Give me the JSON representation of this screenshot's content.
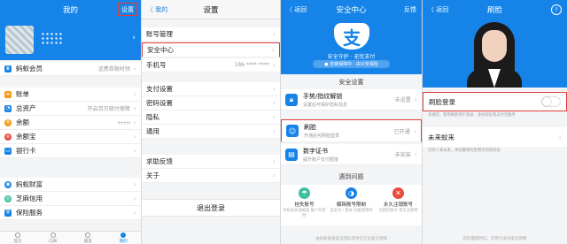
{
  "colors": {
    "brand_blue": "#1583e8",
    "highlight_red": "#e23b3b",
    "background": "#f3f4f6"
  },
  "panel1": {
    "title": "我的",
    "settings": "设置",
    "menu": [
      {
        "label": "蚂蚁会员",
        "value": "话费券限时领 ",
        "icon": "crown-icon",
        "color": "#1583e8"
      },
      {
        "label": "账单",
        "value": "",
        "icon": "bill-icon",
        "color": "#f39c12"
      },
      {
        "label": "总资产",
        "value": "开启百万级付保障",
        "icon": "pie-icon",
        "color": "#1583e8"
      },
      {
        "label": "余额",
        "value": "",
        "icon": "coin-icon",
        "color": "#f39c12"
      },
      {
        "label": "余额宝",
        "value": "",
        "icon": "yuebao-icon",
        "color": "#e84c3d"
      },
      {
        "label": "银行卡",
        "value": "",
        "icon": "card-icon",
        "color": "#1583e8"
      },
      {
        "label": "蚂蚁财富",
        "value": "",
        "icon": "wealth-icon",
        "color": "#1583e8"
      },
      {
        "label": "芝麻信用",
        "value": "",
        "icon": "sesame-icon",
        "color": "#3ebea1"
      },
      {
        "label": "保险服务",
        "value": "",
        "icon": "shield-icon",
        "color": "#1583e8"
      }
    ],
    "tabs": [
      "首页",
      "口碑",
      "朋友",
      "我的"
    ]
  },
  "panel2": {
    "back": "〈 我的",
    "title": "设置",
    "items": [
      {
        "label": "账号管理",
        "value": ""
      },
      {
        "label": "安全中心",
        "value": ""
      },
      {
        "label": "手机号",
        "value": "186 **** **** "
      },
      {
        "label": "支付设置",
        "value": ""
      },
      {
        "label": "密码设置",
        "value": ""
      },
      {
        "label": "隐私",
        "value": ""
      },
      {
        "label": "通用",
        "value": ""
      },
      {
        "label": "求助反馈",
        "value": ""
      },
      {
        "label": "关于",
        "value": ""
      }
    ],
    "logout": "退出登录"
  },
  "panel3": {
    "back": "〈 返回",
    "title": "安全中心",
    "feedback": "反馈",
    "shield_char": "支",
    "hero_line1": "安全守护 · 无忧支付",
    "hero_line2": "● 您被保障中 · 由众安保险",
    "section_settings": "安全设置",
    "settings": [
      {
        "title": "手势/指纹解锁",
        "subtitle": "设置后可保护隐私信息",
        "status": "未设置",
        "icon": "lock-icon"
      },
      {
        "title": "刷脸",
        "subtitle": "开通后可刷脸登录",
        "status": "已开通",
        "icon": "face-icon"
      },
      {
        "title": "数字证书",
        "subtitle": "提升账户支付额度",
        "status": "未安装",
        "icon": "cert-icon"
      }
    ],
    "section_problems": "遇到问题",
    "problems": [
      {
        "title": "挂失账号",
        "desc": "手机丢失或被盗 账户异常时",
        "color": "#3ebea1",
        "icon": "umbrella-icon"
      },
      {
        "title": "解除账号限制",
        "desc": "当支付 / 登录 功能受限时",
        "color": "#1583e8",
        "icon": "unlock-icon"
      },
      {
        "title": "永久注销账号",
        "desc": "注销后账号 将无法使用",
        "color": "#e84c3d",
        "icon": "delete-icon"
      }
    ],
    "footer": "由蚂蚁金服安全团队提供全方位安全保障"
  },
  "panel4": {
    "back": "〈 返回",
    "title": "刷脸",
    "help": "?",
    "toggle_label": "刷脸登录",
    "toggle_note": "开通后，使用刷脸用于登录、身份验证等支付宝服务",
    "future_label": "未来蚁来",
    "future_note": "点亮人来未来，体验最新的生物识别黑科技",
    "footer": "您的面部特征，仅用于身份安全保障"
  }
}
